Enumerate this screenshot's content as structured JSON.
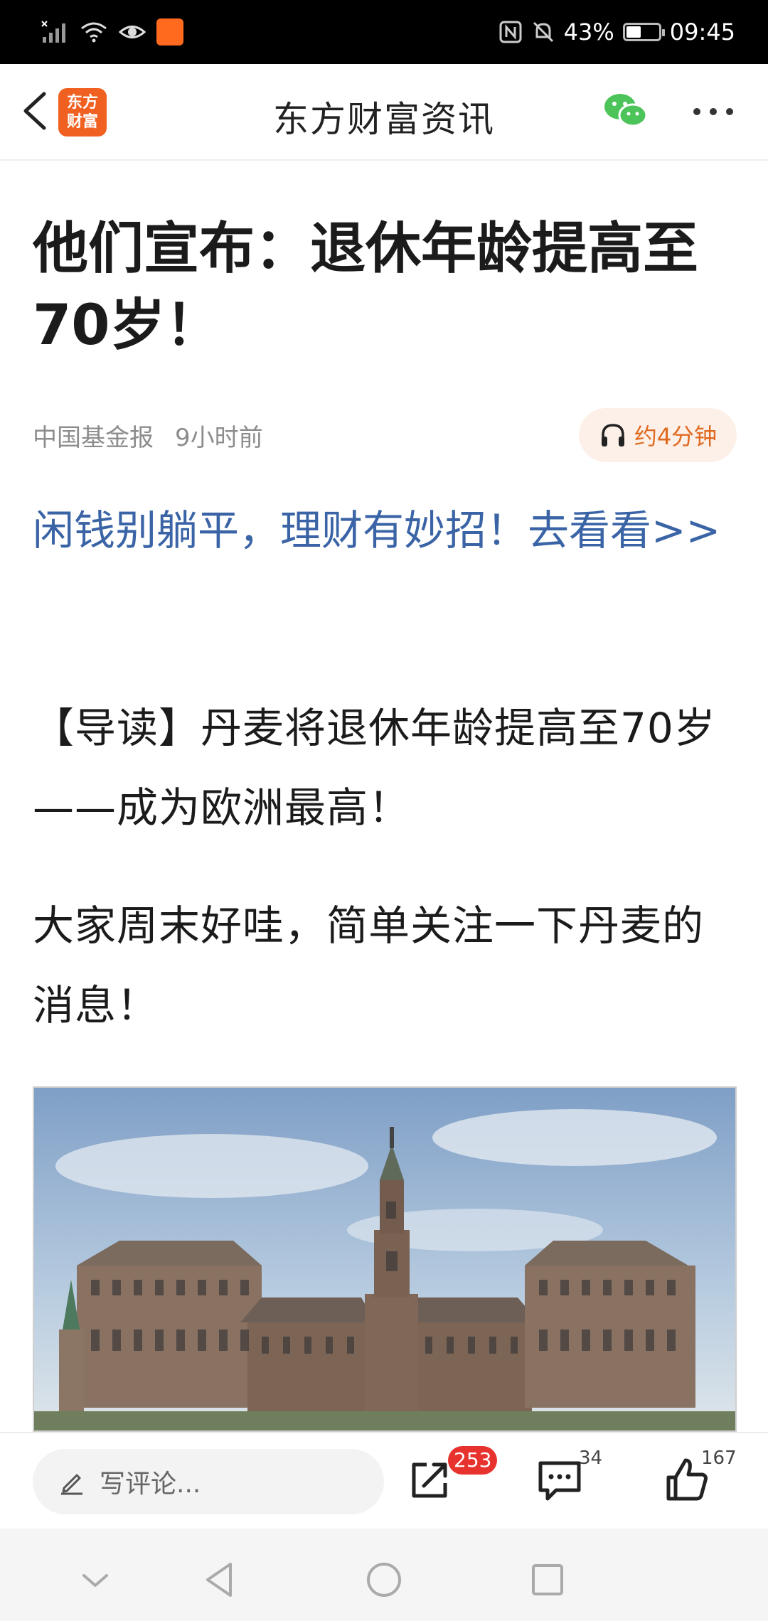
{
  "status_bar": {
    "battery_percent_text": "43%",
    "battery_level": 0.43,
    "time": "09:45"
  },
  "app_bar": {
    "logo_text": "东方\n财富",
    "title": "东方财富资讯"
  },
  "article": {
    "headline": "他们宣布：退休年龄提高至70岁！",
    "source": "中国基金报",
    "time_ago": "9小时前",
    "listen_label": "约4分钟",
    "promo_link": "闲钱别躺平，理财有妙招！去看看>>",
    "paragraphs": [
      "【导读】丹麦将退休年龄提高至70岁——成为欧洲最高！",
      "大家周末好哇，简单关注一下丹麦的消息！"
    ]
  },
  "action_bar": {
    "comment_placeholder": "写评论...",
    "share_badge": "253",
    "comments_count": "34",
    "likes_count": "167"
  },
  "colors": {
    "brand_orange": "#f06020",
    "link_blue": "#3a64a6",
    "badge_red": "#e8322d",
    "wechat_green": "#4cc45a"
  }
}
